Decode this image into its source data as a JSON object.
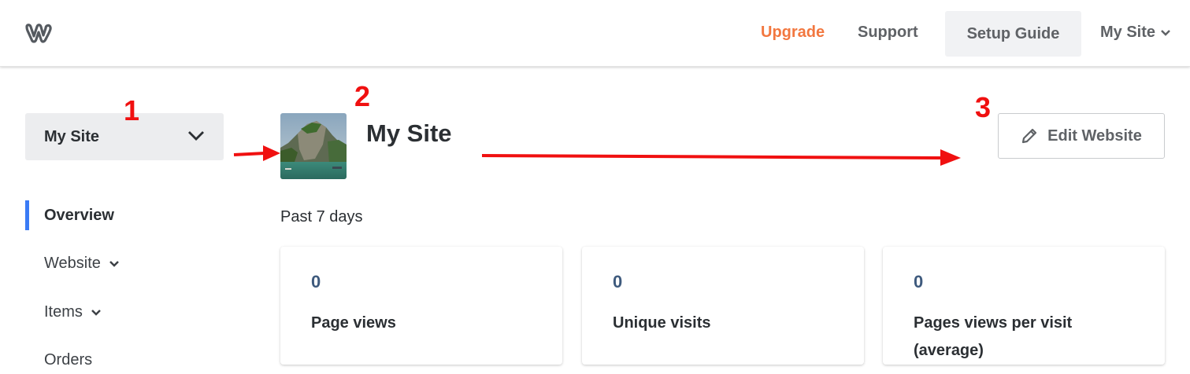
{
  "header": {
    "logo_icon": "weebly-w-icon",
    "upgrade_label": "Upgrade",
    "support_label": "Support",
    "setup_guide_label": "Setup Guide",
    "site_menu_label": "My Site",
    "upgrade_color": "#f2773f"
  },
  "sidebar": {
    "site_select_label": "My Site",
    "items": [
      {
        "label": "Overview",
        "active": true
      },
      {
        "label": "Website",
        "has_caret": true
      },
      {
        "label": "Items",
        "has_caret": true
      },
      {
        "label": "Orders"
      }
    ],
    "active_color": "#3a7bf5"
  },
  "main": {
    "site_title": "My Site",
    "edit_button_label": "Edit Website",
    "period_label": "Past 7 days",
    "stats": [
      {
        "value": "0",
        "label": "Page views"
      },
      {
        "value": "0",
        "label": "Unique visits"
      },
      {
        "value": "0",
        "label": "Pages views per visit (average)"
      }
    ]
  },
  "annotations": {
    "n1": "1",
    "n2": "2",
    "n3": "3",
    "color": "#f01010"
  }
}
